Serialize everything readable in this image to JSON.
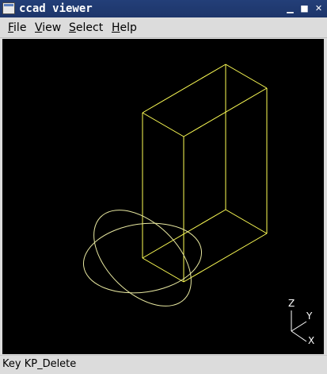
{
  "window": {
    "title": "ccad viewer",
    "controls": {
      "minimize": "▁",
      "maximize": "■",
      "close": "✕"
    },
    "title_color": "#1d356a"
  },
  "menu": {
    "file": {
      "accel": "F",
      "rest": "ile"
    },
    "view": {
      "accel": "V",
      "rest": "iew"
    },
    "select": {
      "accel": "S",
      "rest": "elect"
    },
    "help": {
      "accel": "H",
      "rest": "elp"
    }
  },
  "viewport": {
    "background": "#000000",
    "wire_color": "#ffff55",
    "circle_color": "#e8e8a0",
    "axes": {
      "z": "Z",
      "y": "Y",
      "x": "X"
    }
  },
  "status": {
    "text": "Key KP_Delete"
  }
}
